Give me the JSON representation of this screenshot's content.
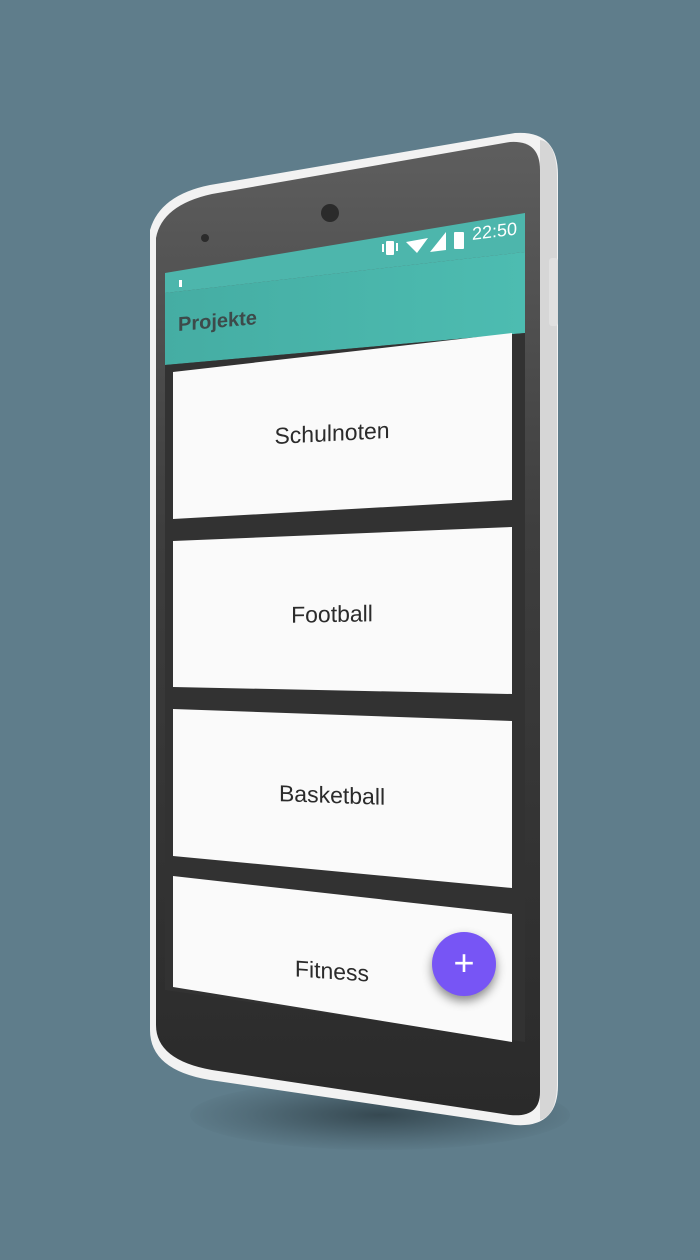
{
  "status_bar": {
    "time": "22:50",
    "icons": [
      "vibrate-icon",
      "wifi-icon",
      "signal-icon",
      "battery-icon",
      "notification-icon"
    ],
    "color": "#4db6ac"
  },
  "app_bar": {
    "title": "Projekte",
    "color": "#4db6ac"
  },
  "projects": [
    {
      "label": "Schulnoten"
    },
    {
      "label": "Football"
    },
    {
      "label": "Basketball"
    },
    {
      "label": "Fitness"
    }
  ],
  "fab": {
    "label": "+",
    "icon": "plus-icon",
    "color": "#7755f5"
  },
  "background_color": "#5f7d8b"
}
